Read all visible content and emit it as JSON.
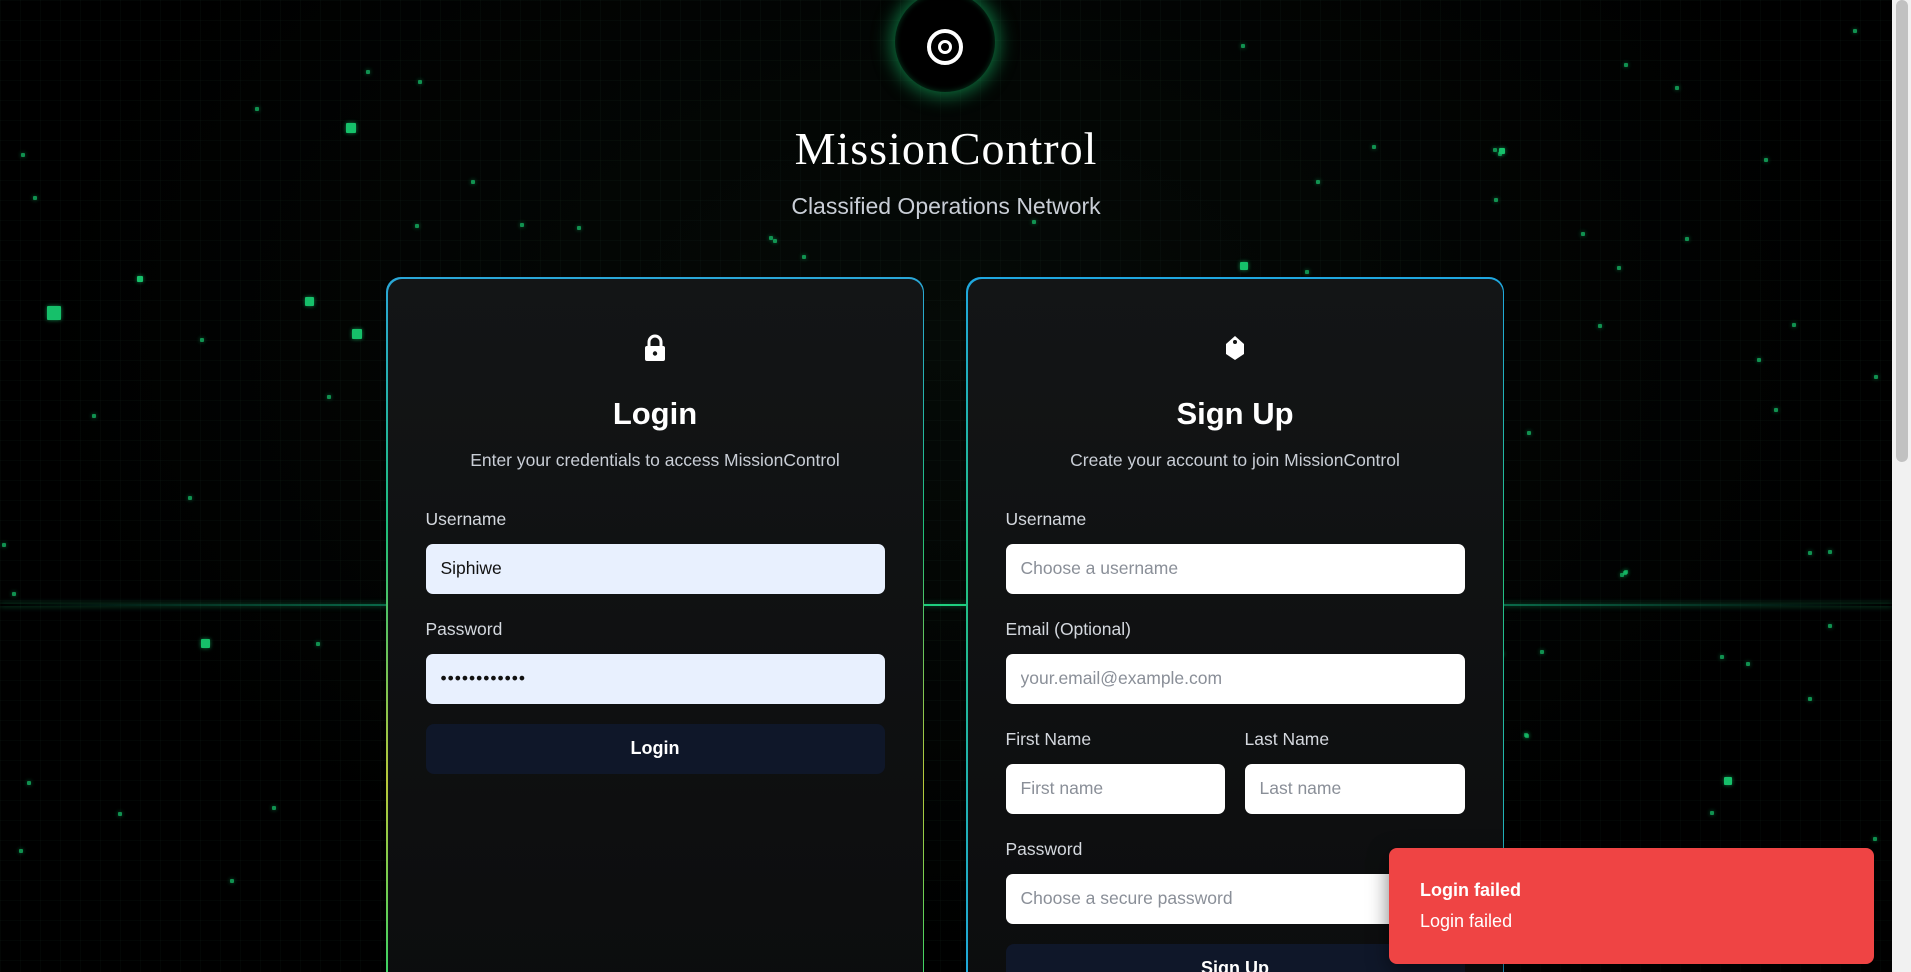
{
  "brand": {
    "title": "MissionControl",
    "subtitle": "Classified Operations Network",
    "logo_icon": "target-icon"
  },
  "login": {
    "icon": "lock-icon",
    "title": "Login",
    "description": "Enter your credentials to access MissionControl",
    "username_label": "Username",
    "username_value": "Siphiwe",
    "password_label": "Password",
    "password_value": "••••••••••••",
    "submit_label": "Login"
  },
  "signup": {
    "icon": "tag-icon",
    "title": "Sign Up",
    "description": "Create your account to join MissionControl",
    "username_label": "Username",
    "username_placeholder": "Choose a username",
    "email_label": "Email (Optional)",
    "email_placeholder": "your.email@example.com",
    "first_name_label": "First Name",
    "first_name_placeholder": "First name",
    "last_name_label": "Last Name",
    "last_name_placeholder": "Last name",
    "password_label": "Password",
    "password_placeholder": "Choose a secure password",
    "submit_label": "Sign Up"
  },
  "toast": {
    "title": "Login failed",
    "message": "Login failed",
    "color": "#ef4444"
  },
  "colors": {
    "accent": "#16c06a",
    "button_bg": "#0f1729",
    "background": "#000000"
  }
}
